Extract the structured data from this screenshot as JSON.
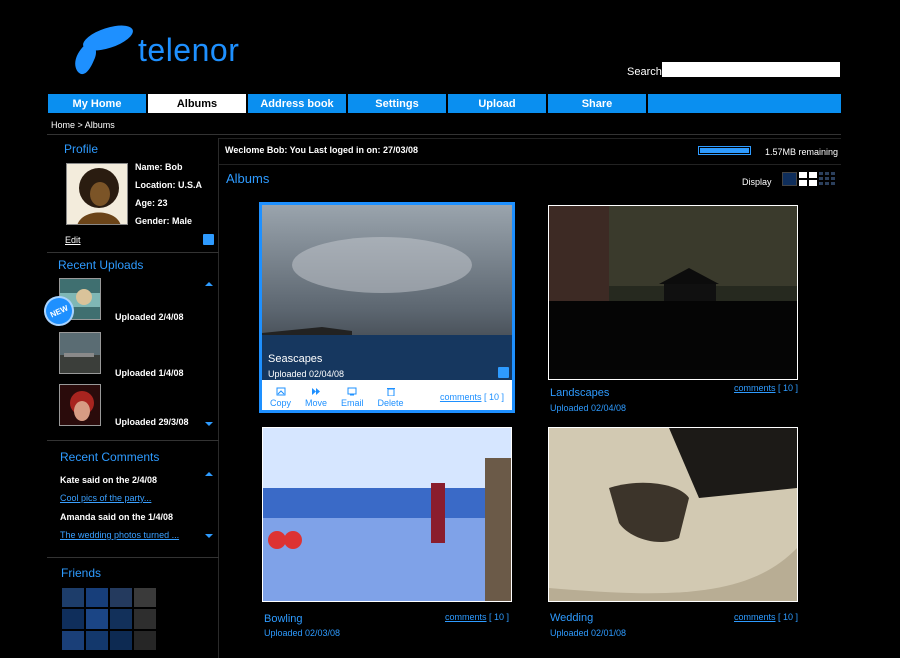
{
  "brand": {
    "name": "telenor",
    "color": "#1e90ff"
  },
  "search": {
    "label": "Search",
    "value": ""
  },
  "nav": {
    "tabs": [
      "My Home",
      "Albums",
      "Address book",
      "Settings",
      "Upload",
      "Share"
    ],
    "active": "Albums"
  },
  "breadcrumb": "Home > Albums",
  "profile": {
    "title": "Profile",
    "name": "Name: Bob",
    "location": "Location: U.S.A",
    "age": "Age: 23",
    "gender": "Gender: Male",
    "edit": "Edit"
  },
  "recent_uploads": {
    "title": "Recent Uploads",
    "new_badge": "NEW",
    "items": [
      "Uploaded 2/4/08",
      "Uploaded 1/4/08",
      "Uploaded 29/3/08"
    ]
  },
  "recent_comments": {
    "title": "Recent Comments",
    "items": [
      {
        "who": "Kate said on the 2/4/08",
        "text": "Cool pics of the party..."
      },
      {
        "who": "Amanda said on the 1/4/08",
        "text": "The wedding photos turned ..."
      }
    ]
  },
  "friends": {
    "title": "Friends"
  },
  "welcome": "Weclome Bob: You Last loged in on: 27/03/08",
  "quota": {
    "text": "1.57MB remaining",
    "fill_fraction": 1.0
  },
  "albums": {
    "title": "Albums",
    "display_label": "Display",
    "actions": [
      "Copy",
      "Move",
      "Email",
      "Delete"
    ],
    "items": [
      {
        "name": "Seascapes",
        "date": "Uploaded 02/04/08",
        "comments_label": "comments",
        "comments_count": "[ 10 ]"
      },
      {
        "name": "Landscapes",
        "date": "Uploaded 02/04/08",
        "comments_label": "comments",
        "comments_count": "[ 10 ]"
      },
      {
        "name": "Bowling",
        "date": "Uploaded 02/03/08",
        "comments_label": "comments",
        "comments_count": "[ 10 ]"
      },
      {
        "name": "Wedding",
        "date": "Uploaded 02/01/08",
        "comments_label": "comments",
        "comments_count": "[ 10 ]"
      }
    ]
  }
}
